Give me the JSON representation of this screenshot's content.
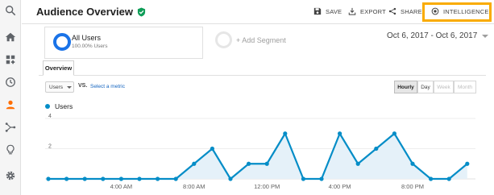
{
  "header": {
    "title": "Audience Overview",
    "actions": {
      "save": "SAVE",
      "export": "EXPORT",
      "share": "SHARE",
      "intelligence": "INTELLIGENCE"
    }
  },
  "sidebar": {
    "icons": [
      "search-icon",
      "home-icon",
      "customization-icon",
      "realtime-icon",
      "audience-icon",
      "acquisition-icon",
      "behavior-icon",
      "admin-icon"
    ]
  },
  "segments": {
    "current": {
      "name": "All Users",
      "detail": "100.00% Users"
    },
    "add_label": "+ Add Segment"
  },
  "date_range": "Oct 6, 2017 - Oct 6, 2017",
  "tabs": [
    "Overview"
  ],
  "metric_row": {
    "selected_metric": "Users",
    "vs_label": "VS.",
    "select_metric_link": "Select a metric",
    "granularity": [
      "Hourly",
      "Day",
      "Week",
      "Month"
    ],
    "active_granularity": "Hourly"
  },
  "colors": {
    "accent": "#1a73e8",
    "series": "#058dc7",
    "area": "#e5f1f9",
    "highlight_border": "#f9ab00",
    "active_nav": "#ff6d00"
  },
  "chart_data": {
    "type": "area",
    "series": [
      {
        "name": "Users",
        "values": [
          0,
          0,
          0,
          0,
          0,
          0,
          0,
          0,
          1,
          2,
          0,
          1,
          1,
          3,
          0,
          0,
          3,
          1,
          2,
          3,
          1,
          0,
          0,
          1
        ]
      }
    ],
    "x_tick_labels": [
      "4:00 AM",
      "8:00 AM",
      "12:00 PM",
      "4:00 PM",
      "8:00 PM"
    ],
    "y_tick_labels": [
      "4",
      "2"
    ],
    "ylim": [
      0,
      4
    ],
    "grid": true,
    "legend_position": "top-left"
  }
}
